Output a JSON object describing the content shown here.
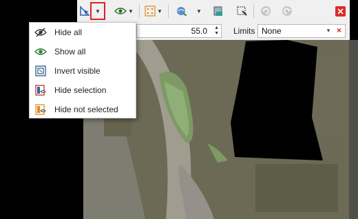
{
  "toolbar": {
    "icons": [
      "select-tool-icon",
      "dropdown-arrow",
      "visibility-icon",
      "grid-icon",
      "globe-refresh-icon",
      "layer-icon",
      "select-point-icon",
      "undo-icon",
      "redo-icon",
      "close-icon"
    ]
  },
  "menu": {
    "items": [
      {
        "label": "Hide all",
        "icon": "eye-slash-icon"
      },
      {
        "label": "Show all",
        "icon": "eye-icon"
      },
      {
        "label": "Invert visible",
        "icon": "invert-icon"
      },
      {
        "label": "Hide selection",
        "icon": "hide-selection-icon"
      },
      {
        "label": "Hide not selected",
        "icon": "hide-not-selected-icon"
      }
    ]
  },
  "field": {
    "value": "55.0"
  },
  "limits": {
    "label": "Limits",
    "value": "None"
  },
  "colors": {
    "accent_red": "#e02020",
    "toolbar_bg": "#f0f0f0"
  }
}
